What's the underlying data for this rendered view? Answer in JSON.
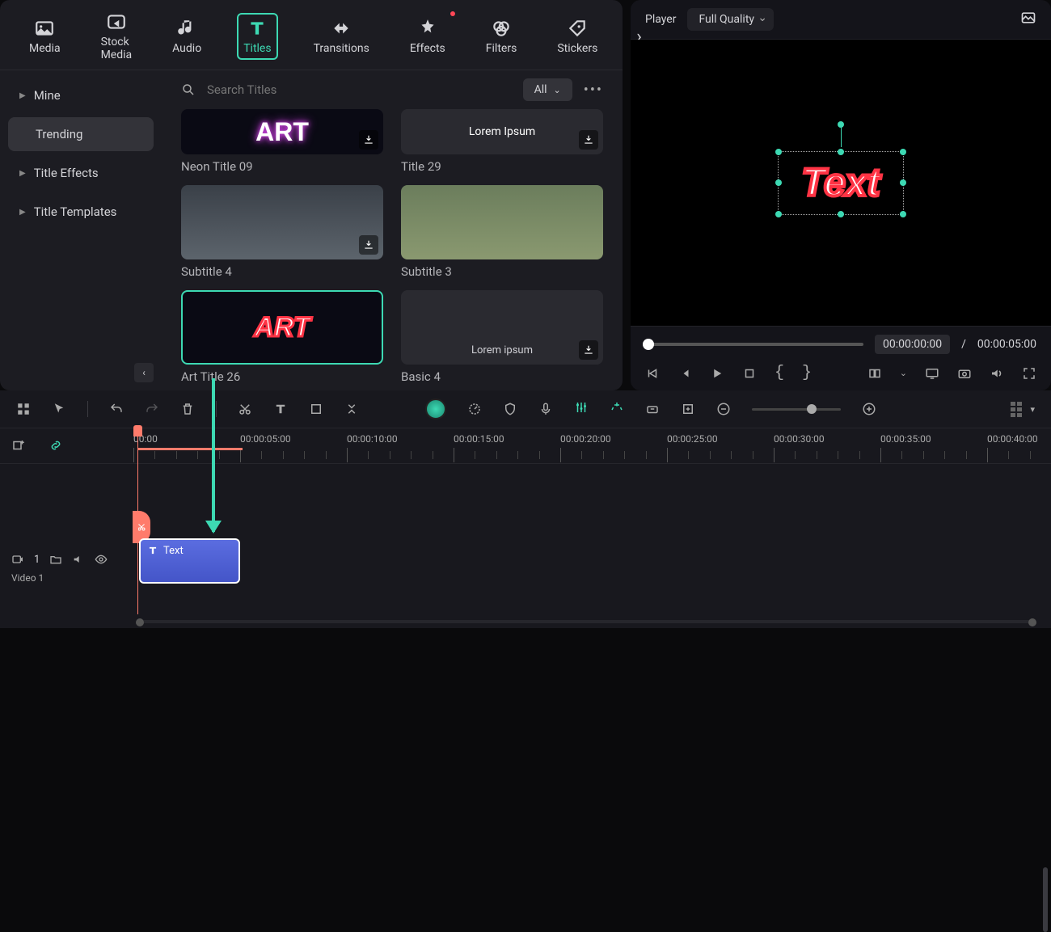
{
  "tabs": [
    {
      "id": "media",
      "label": "Media"
    },
    {
      "id": "stock",
      "label": "Stock Media"
    },
    {
      "id": "audio",
      "label": "Audio"
    },
    {
      "id": "titles",
      "label": "Titles"
    },
    {
      "id": "transitions",
      "label": "Transitions"
    },
    {
      "id": "effects",
      "label": "Effects"
    },
    {
      "id": "filters",
      "label": "Filters"
    },
    {
      "id": "stickers",
      "label": "Stickers"
    }
  ],
  "active_tab": "titles",
  "sidebar": {
    "items": [
      {
        "label": "Mine",
        "active": false,
        "expandable": true
      },
      {
        "label": "Trending",
        "active": true,
        "expandable": false
      },
      {
        "label": "Title Effects",
        "active": false,
        "expandable": true
      },
      {
        "label": "Title Templates",
        "active": false,
        "expandable": true
      }
    ]
  },
  "search": {
    "placeholder": "Search Titles"
  },
  "filter": {
    "label": "All"
  },
  "cards": [
    {
      "id": "neon09",
      "label": "Neon Title 09",
      "preview": "ART",
      "style": "neon",
      "partial": true
    },
    {
      "id": "title29",
      "label": "Title 29",
      "preview": "Lorem Ipsum",
      "style": "lorem",
      "partial": true
    },
    {
      "id": "sub4",
      "label": "Subtitle 4",
      "preview": "",
      "style": "sub2"
    },
    {
      "id": "sub3",
      "label": "Subtitle 3",
      "preview": "",
      "style": "sub"
    },
    {
      "id": "art26",
      "label": "Art Title 26",
      "preview": "ART",
      "style": "art",
      "selected": true
    },
    {
      "id": "basic4",
      "label": "Basic 4",
      "preview": "Lorem ipsum",
      "style": "lorem2"
    }
  ],
  "player": {
    "title": "Player",
    "quality": "Full Quality",
    "preview_text": "Text",
    "current": "00:00:00:00",
    "sep": "/",
    "total": "00:00:05:00"
  },
  "timeline": {
    "marks": [
      "00:00",
      "00:00:05:00",
      "00:00:10:00",
      "00:00:15:00",
      "00:00:20:00",
      "00:00:25:00",
      "00:00:30:00",
      "00:00:35:00",
      "00:00:40:00"
    ],
    "track_num": "1",
    "track_name": "Video 1",
    "clip_label": "Text"
  }
}
